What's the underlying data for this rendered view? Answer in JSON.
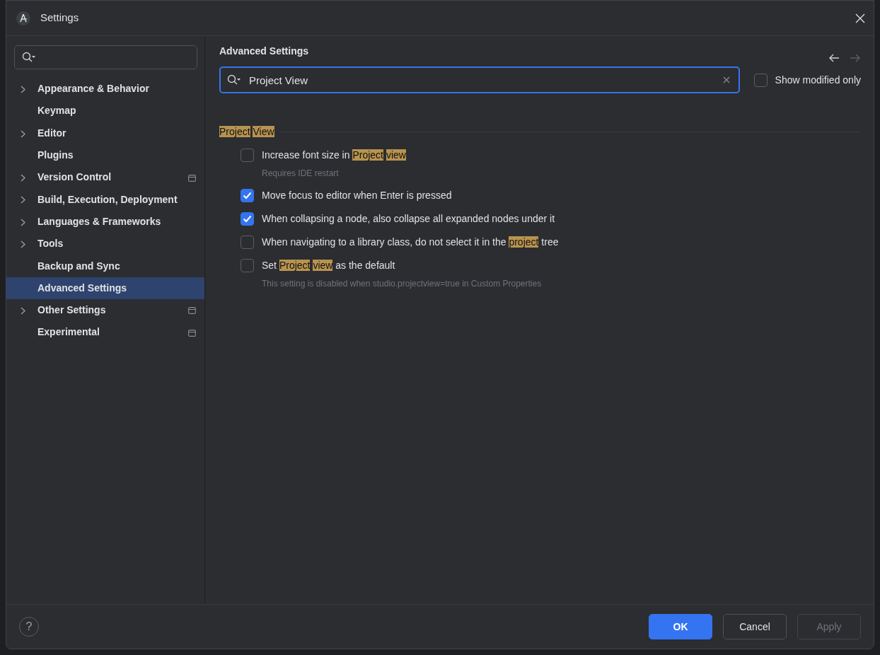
{
  "window": {
    "title": "Settings"
  },
  "sidebar": {
    "items": [
      {
        "label": "Appearance & Behavior",
        "expandable": true,
        "selected": false,
        "marker": false
      },
      {
        "label": "Keymap",
        "expandable": false,
        "selected": false,
        "marker": false
      },
      {
        "label": "Editor",
        "expandable": true,
        "selected": false,
        "marker": false
      },
      {
        "label": "Plugins",
        "expandable": false,
        "selected": false,
        "marker": false
      },
      {
        "label": "Version Control",
        "expandable": true,
        "selected": false,
        "marker": true
      },
      {
        "label": "Build, Execution, Deployment",
        "expandable": true,
        "selected": false,
        "marker": false
      },
      {
        "label": "Languages & Frameworks",
        "expandable": true,
        "selected": false,
        "marker": false
      },
      {
        "label": "Tools",
        "expandable": true,
        "selected": false,
        "marker": false
      },
      {
        "label": "Backup and Sync",
        "expandable": false,
        "selected": false,
        "marker": false
      },
      {
        "label": "Advanced Settings",
        "expandable": false,
        "selected": true,
        "marker": false
      },
      {
        "label": "Other Settings",
        "expandable": true,
        "selected": false,
        "marker": true
      },
      {
        "label": "Experimental",
        "expandable": false,
        "selected": false,
        "marker": true
      }
    ]
  },
  "content": {
    "title": "Advanced Settings",
    "back_enabled": true,
    "forward_enabled": false,
    "search": {
      "value": "Project View"
    },
    "show_modified_only": {
      "label": "Show modified only",
      "checked": false
    },
    "groups": [
      {
        "title": [
          {
            "text": "Project",
            "highlight": true
          },
          {
            "text": "View",
            "highlight": true
          }
        ],
        "settings": [
          {
            "label": [
              {
                "text": "Increase font size in",
                "highlight": false
              },
              {
                "text": "Project",
                "highlight": true
              },
              {
                "text": "view",
                "highlight": true
              }
            ],
            "checked": false,
            "note": "Requires IDE restart"
          },
          {
            "label": [
              {
                "text": "Move focus to editor when Enter is pressed",
                "highlight": false
              }
            ],
            "checked": true
          },
          {
            "label": [
              {
                "text": "When collapsing a node, also collapse all expanded nodes under it",
                "highlight": false
              }
            ],
            "checked": true
          },
          {
            "label": [
              {
                "text": "When navigating to a library class, do not select it in the",
                "highlight": false
              },
              {
                "text": "project",
                "highlight": true
              },
              {
                "text": "tree",
                "highlight": false
              }
            ],
            "checked": false
          },
          {
            "label": [
              {
                "text": "Set",
                "highlight": false
              },
              {
                "text": "Project",
                "highlight": true
              },
              {
                "text": "view",
                "highlight": true
              },
              {
                "text": "as the default",
                "highlight": false
              }
            ],
            "checked": false,
            "note": "This setting is disabled when studio.projectview=true in Custom Properties"
          }
        ]
      }
    ]
  },
  "footer": {
    "help": "?",
    "buttons": [
      {
        "label": "OK",
        "kind": "primary",
        "disabled": false
      },
      {
        "label": "Cancel",
        "kind": "secondary",
        "disabled": false
      },
      {
        "label": "Apply",
        "kind": "secondary",
        "disabled": true
      }
    ]
  }
}
